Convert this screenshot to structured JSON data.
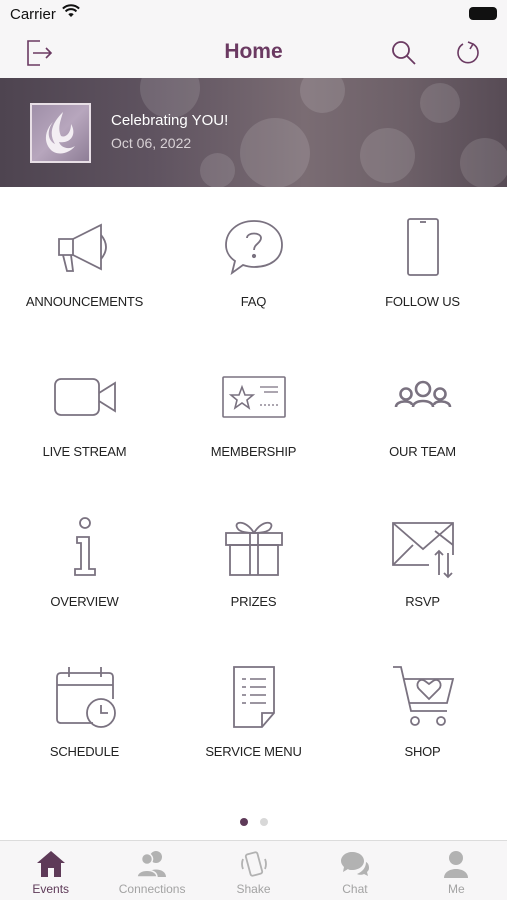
{
  "status_bar": {
    "carrier": "Carrier"
  },
  "nav": {
    "title": "Home"
  },
  "banner": {
    "title": "Celebrating YOU!",
    "date": "Oct 06, 2022"
  },
  "tiles": [
    {
      "label": "ANNOUNCEMENTS",
      "icon": "megaphone-icon"
    },
    {
      "label": "FAQ",
      "icon": "question-bubble-icon"
    },
    {
      "label": "FOLLOW US",
      "icon": "phone-icon"
    },
    {
      "label": "LIVE STREAM",
      "icon": "video-camera-icon"
    },
    {
      "label": "MEMBERSHIP",
      "icon": "membership-card-icon"
    },
    {
      "label": "OUR TEAM",
      "icon": "team-icon"
    },
    {
      "label": "OVERVIEW",
      "icon": "info-icon"
    },
    {
      "label": "PRIZES",
      "icon": "gift-icon"
    },
    {
      "label": "RSVP",
      "icon": "envelope-icon"
    },
    {
      "label": "SCHEDULE",
      "icon": "calendar-clock-icon"
    },
    {
      "label": "SERVICE MENU",
      "icon": "document-list-icon"
    },
    {
      "label": "SHOP",
      "icon": "shopping-cart-icon"
    }
  ],
  "pager": {
    "pages": 2,
    "current": 1
  },
  "tabs": [
    {
      "label": "Events",
      "icon": "home-icon",
      "active": true
    },
    {
      "label": "Connections",
      "icon": "people-icon",
      "active": false
    },
    {
      "label": "Shake",
      "icon": "shake-phone-icon",
      "active": false
    },
    {
      "label": "Chat",
      "icon": "chat-icon",
      "active": false
    },
    {
      "label": "Me",
      "icon": "person-icon",
      "active": false
    }
  ],
  "colors": {
    "accent": "#6b3a62",
    "icon_stroke": "#7a7280",
    "tab_inactive": "#a3a3a3"
  }
}
